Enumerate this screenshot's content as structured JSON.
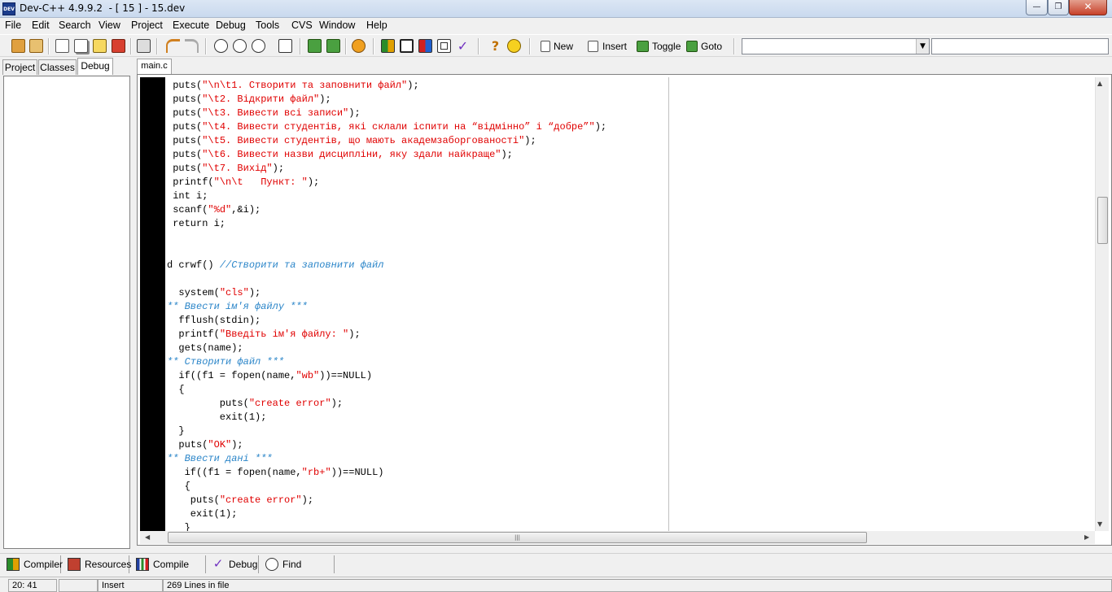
{
  "window": {
    "title": "Dev-C++ 4.9.9.2  - [ 15 ] - 15.dev",
    "icon_text": "DEV",
    "minimize_glyph": "—",
    "maximize_glyph": "❐",
    "close_glyph": "✕"
  },
  "menu": [
    "File",
    "Edit",
    "Search",
    "View",
    "Project",
    "Execute",
    "Debug",
    "Tools",
    "CVS",
    "Window",
    "Help"
  ],
  "toolbar": {
    "new_label": "New",
    "insert_label": "Insert",
    "toggle_label": "Toggle",
    "goto_label": "Goto",
    "combo1_value": "",
    "combo2_value": "",
    "combo_arrow": "▼"
  },
  "left_panel": {
    "tabs": [
      "Project",
      "Classes",
      "Debug"
    ],
    "active_tab": "Debug"
  },
  "editor": {
    "file_tab": "main.c",
    "lines": [
      [
        {
          "t": " puts(",
          "c": ""
        },
        {
          "t": "\"\\n\\t1. Створити та заповнити файл\"",
          "c": "str"
        },
        {
          "t": ");",
          "c": ""
        }
      ],
      [
        {
          "t": " puts(",
          "c": ""
        },
        {
          "t": "\"\\t2. Відкрити файл\"",
          "c": "str"
        },
        {
          "t": ");",
          "c": ""
        }
      ],
      [
        {
          "t": " puts(",
          "c": ""
        },
        {
          "t": "\"\\t3. Вивести всі записи\"",
          "c": "str"
        },
        {
          "t": ");",
          "c": ""
        }
      ],
      [
        {
          "t": " puts(",
          "c": ""
        },
        {
          "t": "\"\\t4. Вивести студентів, які склали іспити на “відмінно” і “добре”\"",
          "c": "str"
        },
        {
          "t": ");",
          "c": ""
        }
      ],
      [
        {
          "t": " puts(",
          "c": ""
        },
        {
          "t": "\"\\t5. Вивести студентів, що мають академзаборгованості\"",
          "c": "str"
        },
        {
          "t": ");",
          "c": ""
        }
      ],
      [
        {
          "t": " puts(",
          "c": ""
        },
        {
          "t": "\"\\t6. Вивести назви дисципліни, яку здали найкраще\"",
          "c": "str"
        },
        {
          "t": ");",
          "c": ""
        }
      ],
      [
        {
          "t": " puts(",
          "c": ""
        },
        {
          "t": "\"\\t7. Вихід\"",
          "c": "str"
        },
        {
          "t": ");",
          "c": ""
        }
      ],
      [
        {
          "t": " printf(",
          "c": ""
        },
        {
          "t": "\"\\n\\t   Пункт: \"",
          "c": "str"
        },
        {
          "t": ");",
          "c": ""
        }
      ],
      [
        {
          "t": " int i;",
          "c": ""
        }
      ],
      [
        {
          "t": " scanf(",
          "c": ""
        },
        {
          "t": "\"%d\"",
          "c": "str"
        },
        {
          "t": ",&i);",
          "c": ""
        }
      ],
      [
        {
          "t": " return i;",
          "c": ""
        }
      ],
      [],
      [],
      [
        {
          "t": "d crwf() ",
          "c": ""
        },
        {
          "t": "//Створити та заповнити файл",
          "c": "cmt"
        }
      ],
      [],
      [
        {
          "t": "  system(",
          "c": ""
        },
        {
          "t": "\"cls\"",
          "c": "str"
        },
        {
          "t": ");",
          "c": ""
        }
      ],
      [
        {
          "t": "** Ввести ім'я файлу ***",
          "c": "cmt"
        }
      ],
      [
        {
          "t": "  fflush(stdin);",
          "c": ""
        }
      ],
      [
        {
          "t": "  printf(",
          "c": ""
        },
        {
          "t": "\"Введіть ім'я файлу: \"",
          "c": "str"
        },
        {
          "t": ");",
          "c": ""
        }
      ],
      [
        {
          "t": "  gets(name);",
          "c": ""
        }
      ],
      [
        {
          "t": "** Створити файл ***",
          "c": "cmt"
        }
      ],
      [
        {
          "t": "  if((f1 = fopen(name,",
          "c": ""
        },
        {
          "t": "\"wb\"",
          "c": "str"
        },
        {
          "t": "))==NULL)",
          "c": ""
        }
      ],
      [
        {
          "t": "  {",
          "c": ""
        }
      ],
      [
        {
          "t": "         puts(",
          "c": ""
        },
        {
          "t": "\"create error\"",
          "c": "str"
        },
        {
          "t": ");",
          "c": ""
        }
      ],
      [
        {
          "t": "         exit(1);",
          "c": ""
        }
      ],
      [
        {
          "t": "  }",
          "c": ""
        }
      ],
      [
        {
          "t": "  puts(",
          "c": ""
        },
        {
          "t": "\"OK\"",
          "c": "str"
        },
        {
          "t": ");",
          "c": ""
        }
      ],
      [
        {
          "t": "** Ввести дані ***",
          "c": "cmt"
        }
      ],
      [
        {
          "t": "   if((f1 = fopen(name,",
          "c": ""
        },
        {
          "t": "\"rb+\"",
          "c": "str"
        },
        {
          "t": "))==NULL)",
          "c": ""
        }
      ],
      [
        {
          "t": "   {",
          "c": ""
        }
      ],
      [
        {
          "t": "    puts(",
          "c": ""
        },
        {
          "t": "\"create error\"",
          "c": "str"
        },
        {
          "t": ");",
          "c": ""
        }
      ],
      [
        {
          "t": "    exit(1);",
          "c": ""
        }
      ],
      [
        {
          "t": "   }",
          "c": ""
        }
      ]
    ],
    "scroll_up": "▲",
    "scroll_down": "▼",
    "scroll_left": "◀",
    "scroll_right": "▶",
    "hthumb_grip": "|||"
  },
  "bottom_tabs": [
    "Compiler",
    "Resources",
    "Compile Log",
    "Debug",
    "Find Results"
  ],
  "status": {
    "position": "20: 41",
    "blank": "",
    "mode": "Insert",
    "lines_info": "269 Lines in file"
  }
}
